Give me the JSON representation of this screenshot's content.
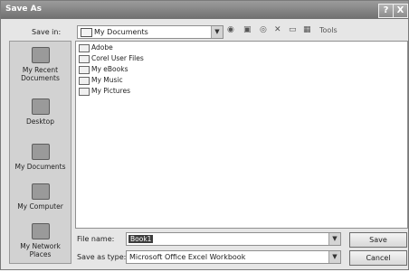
{
  "window": {
    "title": "Save As",
    "help_label": "?",
    "close_label": "X"
  },
  "save_in": {
    "label": "Save in:",
    "value": "My Documents"
  },
  "toolbar": {
    "tools_label": "Tools"
  },
  "places": [
    {
      "label": "My Recent Documents"
    },
    {
      "label": "Desktop"
    },
    {
      "label": "My Documents"
    },
    {
      "label": "My Computer"
    },
    {
      "label": "My Network Places"
    }
  ],
  "files": [
    {
      "name": "Adobe"
    },
    {
      "name": "Corel User Files"
    },
    {
      "name": "My eBooks"
    },
    {
      "name": "My Music"
    },
    {
      "name": "My Pictures"
    }
  ],
  "file_name": {
    "label": "File name:",
    "value": "Book1"
  },
  "save_as_type": {
    "label": "Save as type:",
    "value": "Microsoft Office Excel Workbook"
  },
  "buttons": {
    "save": "Save",
    "cancel": "Cancel"
  }
}
